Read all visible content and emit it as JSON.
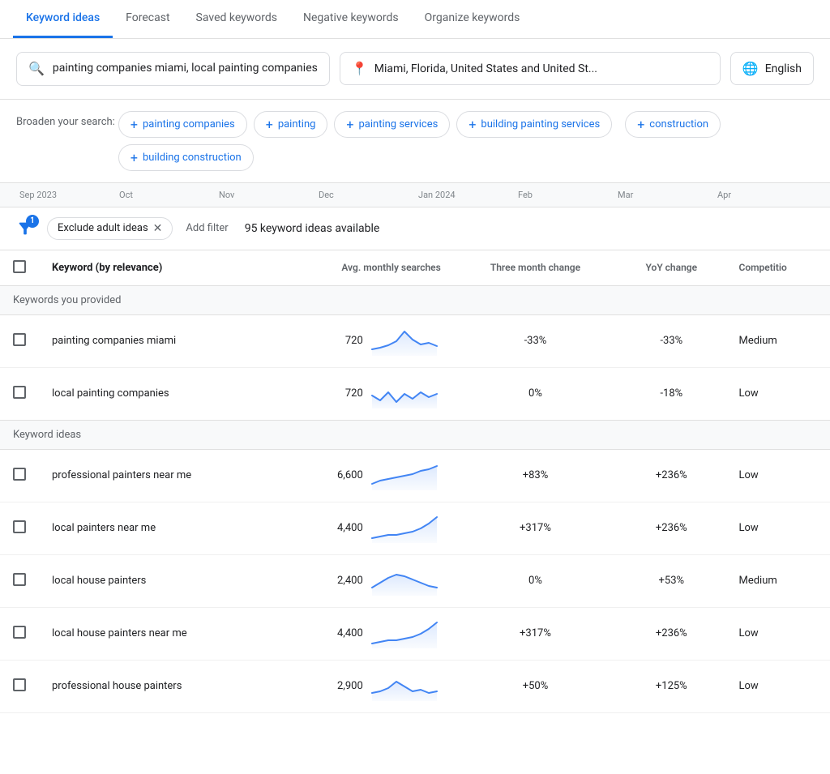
{
  "tabs": [
    {
      "label": "Keyword ideas",
      "active": true
    },
    {
      "label": "Forecast",
      "active": false
    },
    {
      "label": "Saved keywords",
      "active": false
    },
    {
      "label": "Negative keywords",
      "active": false
    },
    {
      "label": "Organize keywords",
      "active": false
    }
  ],
  "searchBox": {
    "text": "painting companies miami, local painting companies",
    "icon": "🔍"
  },
  "locationBox": {
    "text": "Miami, Florida, United States and United St...",
    "icon": "📍"
  },
  "languageBox": {
    "text": "English",
    "icon": "🌐"
  },
  "broadenSearch": {
    "label": "Broaden your search:",
    "chips": [
      {
        "label": "painting companies"
      },
      {
        "label": "painting"
      },
      {
        "label": "painting services"
      },
      {
        "label": "building painting services"
      },
      {
        "label": "construction"
      },
      {
        "label": "building construction"
      }
    ]
  },
  "timeline": {
    "labels": [
      "Sep 2023",
      "Oct",
      "Nov",
      "Dec",
      "Jan 2024",
      "Feb",
      "Mar",
      "Apr"
    ]
  },
  "filterBar": {
    "badgeCount": "1",
    "activeFilter": "Exclude adult ideas",
    "addFilterLabel": "Add filter",
    "keywordCount": "95 keyword ideas available"
  },
  "tableHeaders": {
    "select": "",
    "keyword": "Keyword (by relevance)",
    "avgMonthly": "Avg. monthly searches",
    "threeMonth": "Three month change",
    "yoyChange": "YoY change",
    "competition": "Competitio"
  },
  "sections": [
    {
      "title": "Keywords you provided",
      "rows": [
        {
          "keyword": "painting companies miami",
          "avgMonthly": "720",
          "threeMonthChange": "-33%",
          "yoyChange": "-33%",
          "competition": "Medium",
          "sparklineType": "spike"
        },
        {
          "keyword": "local painting companies",
          "avgMonthly": "720",
          "threeMonthChange": "0%",
          "yoyChange": "-18%",
          "competition": "Low",
          "sparklineType": "wavy"
        }
      ]
    },
    {
      "title": "Keyword ideas",
      "rows": [
        {
          "keyword": "professional painters near me",
          "avgMonthly": "6,600",
          "threeMonthChange": "+83%",
          "yoyChange": "+236%",
          "competition": "Low",
          "sparklineType": "rising"
        },
        {
          "keyword": "local painters near me",
          "avgMonthly": "4,400",
          "threeMonthChange": "+317%",
          "yoyChange": "+236%",
          "competition": "Low",
          "sparklineType": "sharp-rise"
        },
        {
          "keyword": "local house painters",
          "avgMonthly": "2,400",
          "threeMonthChange": "0%",
          "yoyChange": "+53%",
          "competition": "Medium",
          "sparklineType": "hump"
        },
        {
          "keyword": "local house painters near me",
          "avgMonthly": "4,400",
          "threeMonthChange": "+317%",
          "yoyChange": "+236%",
          "competition": "Low",
          "sparklineType": "sharp-rise"
        },
        {
          "keyword": "professional house painters",
          "avgMonthly": "2,900",
          "threeMonthChange": "+50%",
          "yoyChange": "+125%",
          "competition": "Low",
          "sparklineType": "spike-small"
        }
      ]
    }
  ]
}
